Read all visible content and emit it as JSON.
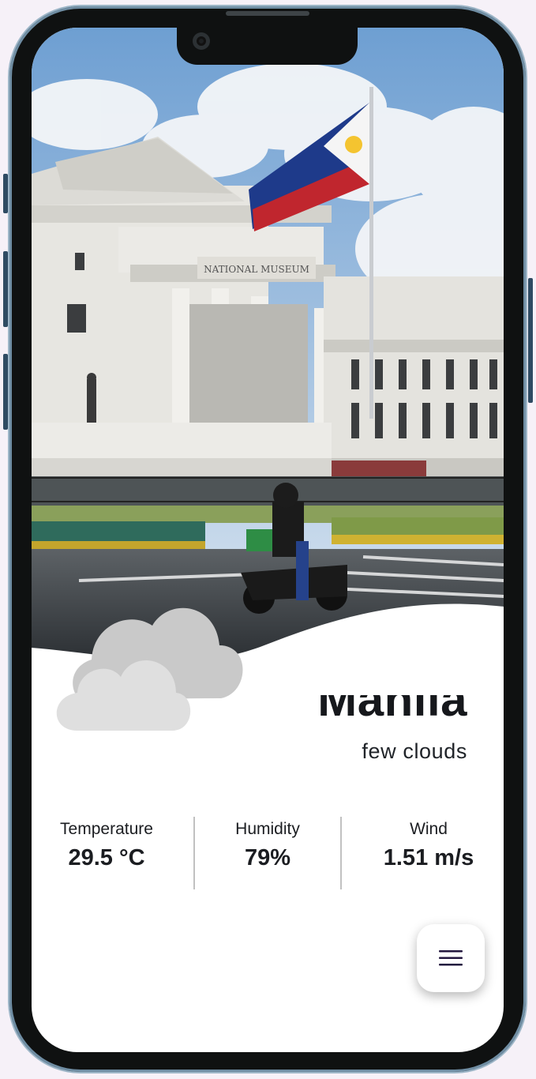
{
  "weather": {
    "city": "Manila",
    "description": "few clouds",
    "icon": "cloud-icon"
  },
  "stats": [
    {
      "label": "Temperature",
      "value": "29.5 °C"
    },
    {
      "label": "Humidity",
      "value": "79%"
    },
    {
      "label": "Wind",
      "value": "1.51 m/s"
    }
  ],
  "fab": {
    "icon": "menu-icon"
  },
  "background_image": {
    "sign_text": "NATIONAL MUSEUM"
  },
  "colors": {
    "text": "#16181c",
    "cloud_back": "#c9c9c9",
    "cloud_front": "#dfdfdf",
    "fab_icon": "#23173f"
  }
}
